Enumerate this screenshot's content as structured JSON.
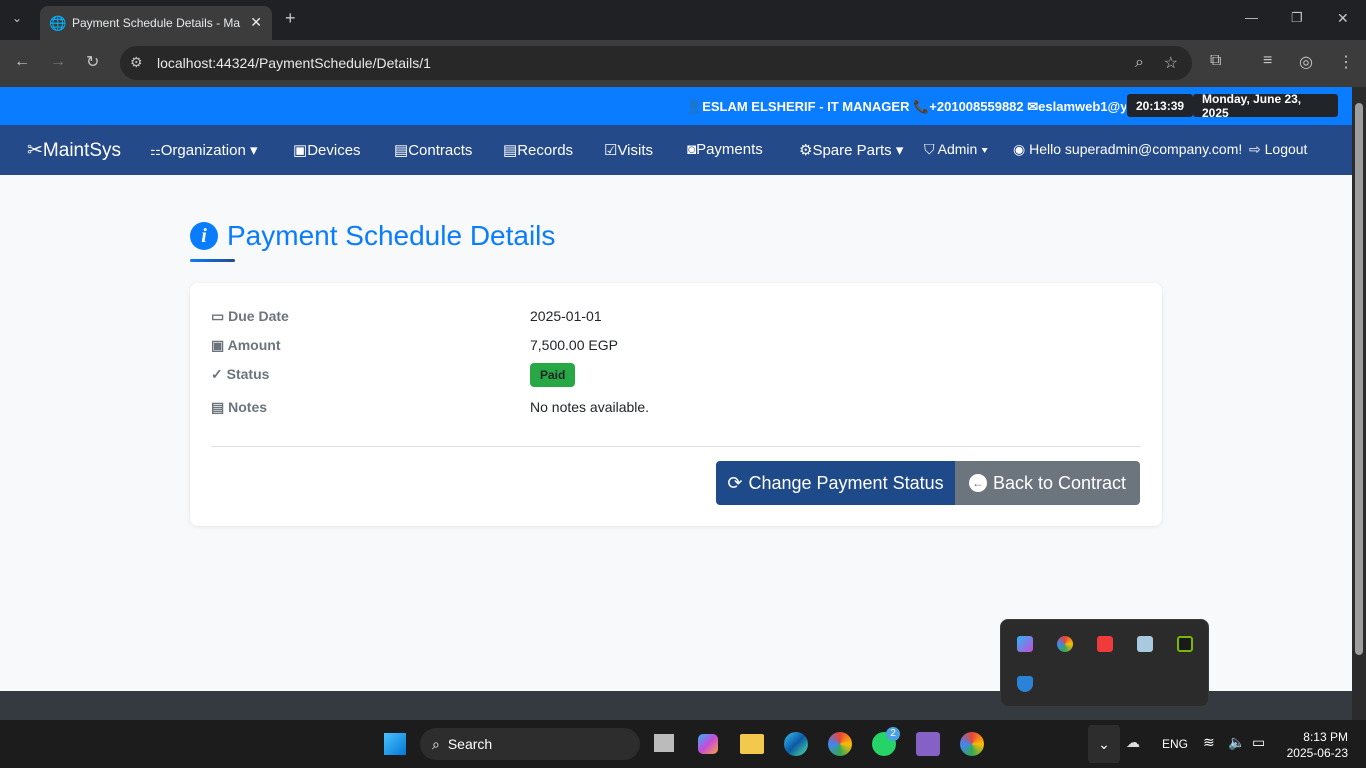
{
  "browser": {
    "tab_title": "Payment Schedule Details - Ma",
    "url": "localhost:44324/PaymentSchedule/Details/1"
  },
  "topbar": {
    "user": "ESLAM ELSHERIF - IT MANAGER",
    "phone": "+201008559882",
    "email": "eslamweb1@yaho",
    "time": "20:13:39",
    "date": "Monday, June 23, 2025"
  },
  "nav": {
    "brand": "MaintSys",
    "items": [
      {
        "label": "Organization",
        "icon": "sitemap-icon"
      },
      {
        "label": "Devices",
        "icon": "cpu-icon"
      },
      {
        "label": "Contracts",
        "icon": "file-icon"
      },
      {
        "label": "Records",
        "icon": "journal-icon"
      },
      {
        "label": "Visits",
        "icon": "calendar-check-icon"
      },
      {
        "label": "Payments",
        "icon": "cash-coin-icon"
      },
      {
        "label": "Spare Parts",
        "icon": "gear-icon"
      },
      {
        "label": "Admin",
        "icon": "shield-icon"
      }
    ],
    "hello": "Hello superadmin@company.com!",
    "logout": "Logout"
  },
  "main": {
    "title": "Payment Schedule Details",
    "fields": [
      {
        "label": "Due Date",
        "value": "2025-01-01"
      },
      {
        "label": "Amount",
        "value": "7,500.00 EGP"
      },
      {
        "label": "Status",
        "value": "Paid"
      },
      {
        "label": "Notes",
        "value": "No notes available."
      }
    ],
    "change_button": "Change Payment Status",
    "back_button": "Back to Contract"
  },
  "colors": {
    "accent": "#0a7cff",
    "nav": "#244a8a",
    "paid": "#28a745"
  },
  "taskbar": {
    "search": "Search",
    "lang": "ENG",
    "time": "8:13 PM",
    "date": "2025-06-23",
    "whatsapp_badge": "2"
  }
}
